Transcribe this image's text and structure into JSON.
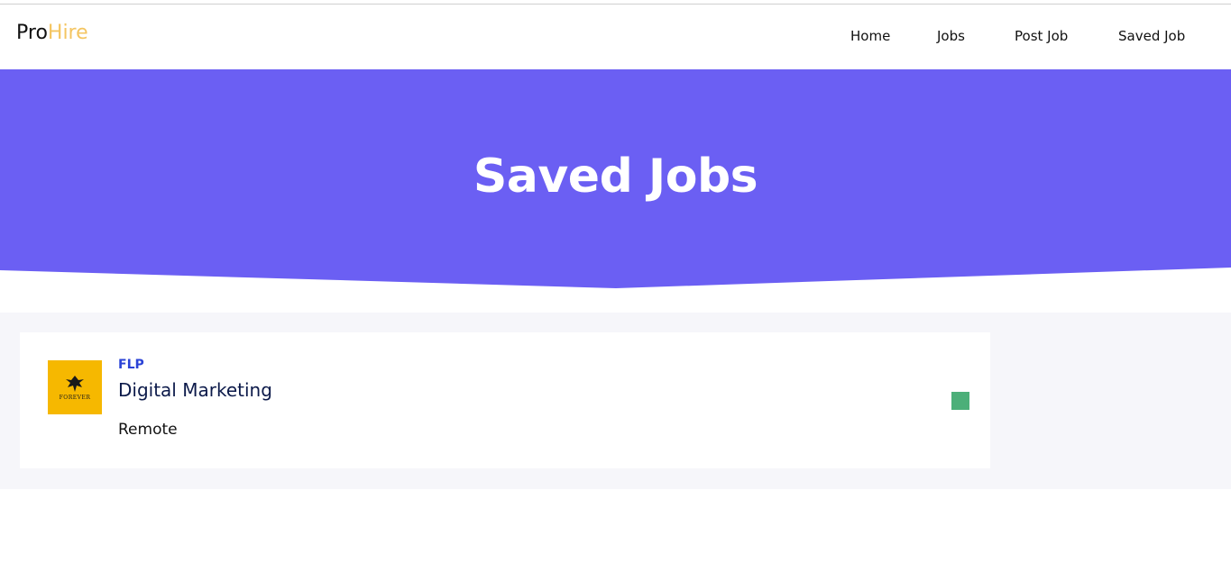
{
  "brand": {
    "part1": "Pro",
    "part2": "Hire",
    "accent_color": "#f4c561"
  },
  "nav": {
    "items": [
      {
        "id": "home",
        "label": "Home"
      },
      {
        "id": "jobs",
        "label": "Jobs"
      },
      {
        "id": "post-job",
        "label": "Post Job"
      },
      {
        "id": "saved-job",
        "label": "Saved Job"
      }
    ]
  },
  "hero": {
    "title": "Saved Jobs",
    "background_color": "#6b5ff3"
  },
  "jobs": [
    {
      "company": "FLP",
      "title": "Digital Marketing",
      "location": "Remote",
      "logo": {
        "icon": "eagle-icon",
        "text": "FOREVER",
        "color": "#f6b800"
      },
      "status_color": "#4caf79"
    }
  ]
}
